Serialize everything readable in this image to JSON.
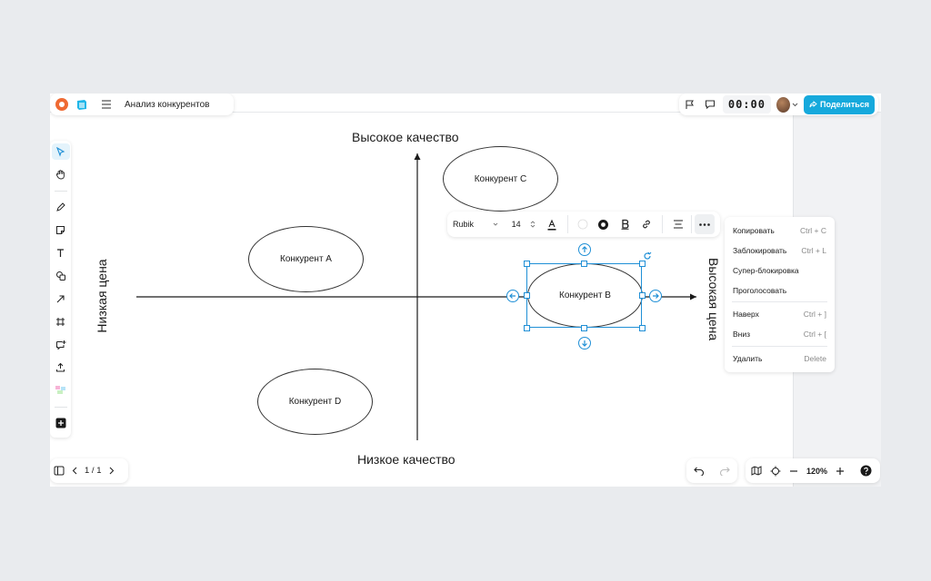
{
  "header": {
    "doc_title": "Анализ конкурентов",
    "timer": "00:00",
    "share_label": "Поделиться"
  },
  "toolbar": {
    "tools": [
      "select-pointer-icon",
      "hand-icon",
      "pen-icon",
      "sticky-note-icon",
      "text-icon",
      "shapes-icon",
      "arrow-icon",
      "frame-icon",
      "comment-icon",
      "upload-icon",
      "stickers-icon",
      "add-icon"
    ]
  },
  "canvas": {
    "axis_top": "Высокое качество",
    "axis_bottom": "Низкое качество",
    "axis_left": "Низкая цена",
    "axis_right": "Высокая цена",
    "competitors": {
      "a": "Конкурент A",
      "b": "Конкурент B",
      "c": "Конкурент C",
      "d": "Конкурент D"
    }
  },
  "format_bar": {
    "font": "Rubik",
    "size": "14"
  },
  "context_menu": {
    "items": [
      {
        "label": "Копировать",
        "shortcut": "Ctrl + C"
      },
      {
        "label": "Заблокировать",
        "shortcut": "Ctrl + L"
      },
      {
        "label": "Супер-блокировка",
        "shortcut": ""
      },
      {
        "label": "Проголосовать",
        "shortcut": ""
      },
      {
        "label": "Наверх",
        "shortcut": "Ctrl + ]"
      },
      {
        "label": "Вниз",
        "shortcut": "Ctrl + ["
      },
      {
        "label": "Удалить",
        "shortcut": "Delete"
      }
    ]
  },
  "footer": {
    "page_indicator": "1 / 1",
    "zoom": "120%"
  },
  "colors": {
    "accent": "#16a9dc",
    "selection": "#1f8fd6",
    "logo_orange": "#ef6a33"
  }
}
